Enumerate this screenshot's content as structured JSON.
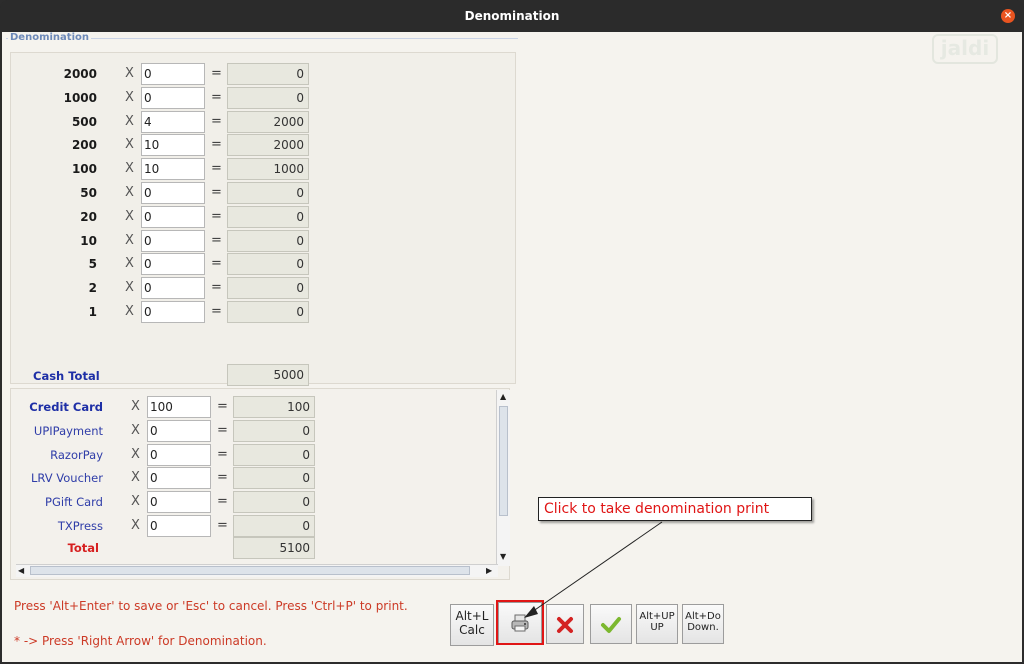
{
  "window": {
    "title": "Denomination",
    "logo_text": "jaldi"
  },
  "group_label": "Denomination",
  "denominations": [
    {
      "label": "2000",
      "qty": "0",
      "amount": "0"
    },
    {
      "label": "1000",
      "qty": "0",
      "amount": "0"
    },
    {
      "label": "500",
      "qty": "4",
      "amount": "2000"
    },
    {
      "label": "200",
      "qty": "10",
      "amount": "2000"
    },
    {
      "label": "100",
      "qty": "10",
      "amount": "1000"
    },
    {
      "label": "50",
      "qty": "0",
      "amount": "0"
    },
    {
      "label": "20",
      "qty": "0",
      "amount": "0"
    },
    {
      "label": "10",
      "qty": "0",
      "amount": "0"
    },
    {
      "label": "5",
      "qty": "0",
      "amount": "0"
    },
    {
      "label": "2",
      "qty": "0",
      "amount": "0"
    },
    {
      "label": "1",
      "qty": "0",
      "amount": "0"
    }
  ],
  "times_symbol": "X",
  "equals_symbol": "=",
  "cash_total": {
    "label": "Cash Total",
    "value": "5000"
  },
  "payments": [
    {
      "label": "Credit Card",
      "qty": "100",
      "amount": "100"
    },
    {
      "label": "UPIPayment",
      "qty": "0",
      "amount": "0"
    },
    {
      "label": "RazorPay",
      "qty": "0",
      "amount": "0"
    },
    {
      "label": "LRV Voucher",
      "qty": "0",
      "amount": "0"
    },
    {
      "label": "PGift Card",
      "qty": "0",
      "amount": "0"
    },
    {
      "label": "TXPress",
      "qty": "0",
      "amount": "0"
    }
  ],
  "payments_total": {
    "label": "Total",
    "value": "5100"
  },
  "hints": {
    "line1": "Press 'Alt+Enter' to save or 'Esc' to cancel. Press 'Ctrl+P' to print.",
    "line2": "* -> Press 'Right Arrow' for Denomination."
  },
  "buttons": {
    "calc_l1": "Alt+L",
    "calc_l2": "Calc",
    "up_l1": "Alt+UP",
    "up_l2": "UP",
    "down_l1": "Alt+Do",
    "down_l2": "Down."
  },
  "callout": "Click to take denomination print",
  "colors": {
    "accent": "#e01515",
    "label_blue": "#1e2fa6",
    "titlebar": "#2b2b2b",
    "close": "#e95420"
  }
}
